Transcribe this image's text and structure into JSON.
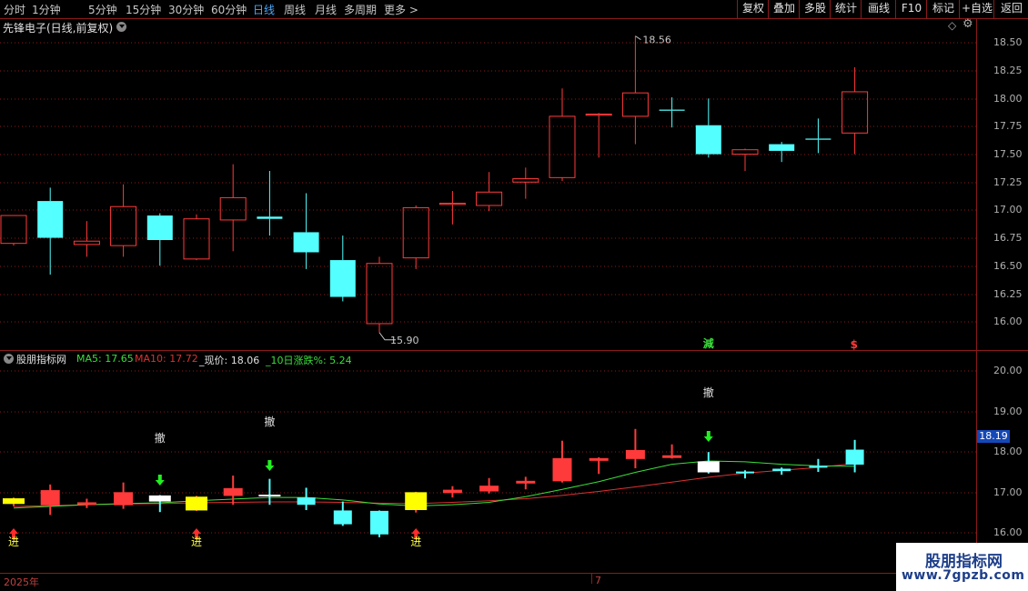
{
  "toolbar": {
    "periods": [
      "分时",
      "1分钟",
      "5分钟",
      "15分钟",
      "30分钟",
      "60分钟",
      "日线",
      "周线",
      "月线",
      "多周期",
      "更多 >"
    ],
    "active_period": "日线",
    "right_buttons": [
      "复权",
      "叠加",
      "多股",
      "统计",
      "画线",
      "F10",
      "标记",
      "+自选",
      "返回"
    ]
  },
  "main_panel": {
    "title": "先锋电子(日线,前复权)",
    "high_label": "18.56",
    "low_label": "15.90",
    "signal_jian": "減",
    "signal_s": "$",
    "price_labels": [
      "18.50",
      "18.25",
      "18.00",
      "17.75",
      "17.50",
      "17.25",
      "17.00",
      "16.75",
      "16.50",
      "16.25",
      "16.00"
    ]
  },
  "indicator_panel": {
    "name": "股朋指标网",
    "ma5": "MA5: 17.65",
    "ma10": "MA10: 17.72",
    "now_price": "_现价: 18.06",
    "change10": "_10日涨跌%: 5.24",
    "price_labels": [
      "20.00",
      "19.00",
      "18.00",
      "17.00",
      "16.00"
    ],
    "current_price_tag": "18.19",
    "buy_label": "进",
    "sell_label": "撤"
  },
  "time_axis": {
    "year_label": "2025年",
    "month_label": "7"
  },
  "watermark": {
    "title": "股朋指标网",
    "url": "www.7gpzb.com"
  },
  "colors": {
    "up": "#ff3a3a",
    "down": "#54ffff",
    "ma5": "#3adf3a",
    "ma10": "#e03030",
    "grid": "#8b1a1a",
    "yellow": "#ffff00"
  },
  "candles": [
    {
      "o": 16.7,
      "h": 16.95,
      "l": 16.68,
      "c": 16.95
    },
    {
      "o": 17.08,
      "h": 17.2,
      "l": 16.42,
      "c": 16.75
    },
    {
      "o": 16.69,
      "h": 16.9,
      "l": 16.58,
      "c": 16.72
    },
    {
      "o": 16.68,
      "h": 17.23,
      "l": 16.58,
      "c": 17.03
    },
    {
      "o": 16.95,
      "h": 16.97,
      "l": 16.5,
      "c": 16.73
    },
    {
      "o": 16.56,
      "h": 16.96,
      "l": 16.55,
      "c": 16.92
    },
    {
      "o": 16.91,
      "h": 17.41,
      "l": 16.63,
      "c": 17.11
    },
    {
      "o": 16.94,
      "h": 17.35,
      "l": 16.77,
      "c": 16.92
    },
    {
      "o": 16.8,
      "h": 17.15,
      "l": 16.47,
      "c": 16.62
    },
    {
      "o": 16.55,
      "h": 16.77,
      "l": 16.18,
      "c": 16.22
    },
    {
      "o": 15.98,
      "h": 16.58,
      "l": 15.9,
      "c": 16.52
    },
    {
      "o": 16.57,
      "h": 17.04,
      "l": 16.47,
      "c": 17.02
    },
    {
      "o": 17.05,
      "h": 17.17,
      "l": 16.87,
      "c": 17.06
    },
    {
      "o": 17.04,
      "h": 17.34,
      "l": 16.99,
      "c": 17.16
    },
    {
      "o": 17.25,
      "h": 17.38,
      "l": 17.1,
      "c": 17.28
    },
    {
      "o": 17.29,
      "h": 18.09,
      "l": 17.26,
      "c": 17.84
    },
    {
      "o": 17.85,
      "h": 17.87,
      "l": 17.47,
      "c": 17.86
    },
    {
      "o": 17.84,
      "h": 18.56,
      "l": 17.59,
      "c": 18.05
    },
    {
      "o": 17.9,
      "h": 18.01,
      "l": 17.74,
      "c": 17.89
    },
    {
      "o": 17.76,
      "h": 18.0,
      "l": 17.47,
      "c": 17.5
    },
    {
      "o": 17.5,
      "h": 17.55,
      "l": 17.35,
      "c": 17.54
    },
    {
      "o": 17.59,
      "h": 17.61,
      "l": 17.43,
      "c": 17.53
    },
    {
      "o": 17.64,
      "h": 17.82,
      "l": 17.51,
      "c": 17.63
    },
    {
      "o": 17.69,
      "h": 18.28,
      "l": 17.5,
      "c": 18.06
    }
  ],
  "bottom_candles": [
    {
      "o": 16.72,
      "h": 16.88,
      "l": 16.66,
      "c": 16.86,
      "style": "yellow"
    },
    {
      "o": 16.7,
      "h": 17.2,
      "l": 16.45,
      "c": 17.05,
      "style": "up"
    },
    {
      "o": 16.72,
      "h": 16.85,
      "l": 16.62,
      "c": 16.75,
      "style": "up"
    },
    {
      "o": 16.7,
      "h": 17.25,
      "l": 16.6,
      "c": 17.0,
      "style": "up"
    },
    {
      "o": 16.78,
      "h": 16.94,
      "l": 16.52,
      "c": 16.93,
      "style": "white"
    },
    {
      "o": 16.56,
      "h": 16.92,
      "l": 16.55,
      "c": 16.9,
      "style": "yellow"
    },
    {
      "o": 16.93,
      "h": 17.42,
      "l": 16.7,
      "c": 17.1,
      "style": "up"
    },
    {
      "o": 16.92,
      "h": 17.34,
      "l": 16.7,
      "c": 16.95,
      "style": "white"
    },
    {
      "o": 16.88,
      "h": 17.12,
      "l": 16.57,
      "c": 16.7,
      "style": "down"
    },
    {
      "o": 16.56,
      "h": 16.78,
      "l": 16.18,
      "c": 16.22,
      "style": "down"
    },
    {
      "o": 16.55,
      "h": 16.56,
      "l": 15.9,
      "c": 15.97,
      "style": "down"
    },
    {
      "o": 16.57,
      "h": 17.02,
      "l": 16.51,
      "c": 17.01,
      "style": "yellow"
    },
    {
      "o": 17.0,
      "h": 17.16,
      "l": 16.88,
      "c": 17.06,
      "style": "up"
    },
    {
      "o": 17.04,
      "h": 17.36,
      "l": 16.98,
      "c": 17.16,
      "style": "up"
    },
    {
      "o": 17.24,
      "h": 17.39,
      "l": 17.08,
      "c": 17.28,
      "style": "up"
    },
    {
      "o": 17.29,
      "h": 18.28,
      "l": 17.25,
      "c": 17.84,
      "style": "up"
    },
    {
      "o": 17.8,
      "h": 17.87,
      "l": 17.46,
      "c": 17.84,
      "style": "up"
    },
    {
      "o": 17.84,
      "h": 18.57,
      "l": 17.6,
      "c": 18.04,
      "style": "up"
    },
    {
      "o": 17.89,
      "h": 18.19,
      "l": 17.84,
      "c": 17.91,
      "style": "up"
    },
    {
      "o": 17.77,
      "h": 18.0,
      "l": 17.47,
      "c": 17.5,
      "style": "white"
    },
    {
      "o": 17.52,
      "h": 17.55,
      "l": 17.35,
      "c": 17.5,
      "style": "down"
    },
    {
      "o": 17.59,
      "h": 17.62,
      "l": 17.44,
      "c": 17.53,
      "style": "down"
    },
    {
      "o": 17.64,
      "h": 17.83,
      "l": 17.51,
      "c": 17.66,
      "style": "down"
    },
    {
      "o": 17.69,
      "h": 18.3,
      "l": 17.5,
      "c": 18.06,
      "style": "down"
    }
  ],
  "ma5": [
    16.62,
    16.66,
    16.7,
    16.73,
    16.75,
    16.8,
    16.84,
    16.88,
    16.88,
    16.82,
    16.72,
    16.67,
    16.7,
    16.76,
    16.9,
    17.08,
    17.27,
    17.5,
    17.7,
    17.78,
    17.76,
    17.7,
    17.66,
    17.65
  ],
  "ma10": [
    16.66,
    16.68,
    16.7,
    16.72,
    16.73,
    16.75,
    16.76,
    16.77,
    16.77,
    16.76,
    16.74,
    16.73,
    16.76,
    16.8,
    16.85,
    16.93,
    17.03,
    17.14,
    17.26,
    17.38,
    17.48,
    17.55,
    17.62,
    17.72
  ],
  "buy_signals": [
    0,
    5,
    11
  ],
  "sell_signals": [
    4,
    7,
    19
  ]
}
